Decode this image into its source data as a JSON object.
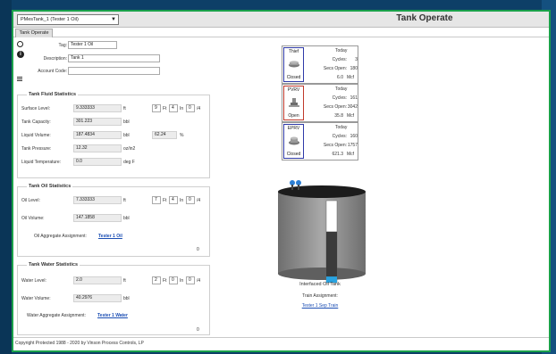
{
  "header": {
    "tank_selector_value": "PMesTank_1 (Tester 1 Oil)",
    "title": "Tank Operate"
  },
  "tabs": [
    {
      "label": "Tank Operate"
    }
  ],
  "info": {
    "tag_label": "Tag:",
    "tag_value": "Tester 1 Oil",
    "description_label": "Description:",
    "description_value": "Tank 1",
    "account_code_label": "Account Code:",
    "account_code_value": ""
  },
  "fluid": {
    "title": "Tank Fluid Statistics",
    "surface_level_label": "Surface Level:",
    "surface_level": "9.333333",
    "surface_level_unit": "ft",
    "ft_value": "9",
    "ft_label": "Ft",
    "in_value": "4",
    "in_label": "In",
    "frac_value": "0",
    "frac_label": "/4",
    "capacity_label": "Tank Capacity:",
    "capacity": "301.223",
    "capacity_unit": "bbl",
    "liquid_volume_label": "Liquid Volume:",
    "liquid_volume": "187.4834",
    "liquid_volume_unit": "bbl",
    "percent": "62.24",
    "percent_unit": "%",
    "pressure_label": "Tank Pressure:",
    "pressure": "12.32",
    "pressure_unit": "oz/in2",
    "temperature_label": "Liquid Temperature:",
    "temperature": "0.0",
    "temperature_unit": "deg F"
  },
  "oil": {
    "title": "Tank Oil Statistics",
    "level_label": "Oil Level:",
    "level": "7.333333",
    "level_unit": "ft",
    "ft_value": "7",
    "ft_label": "Ft",
    "in_value": "4",
    "in_label": "In",
    "frac_value": "0",
    "frac_label": "/4",
    "volume_label": "Oil Volume:",
    "volume": "147.1858",
    "volume_unit": "bbl",
    "aggregate_label": "Oil Aggregate Assignment:",
    "aggregate_link": "Tester 1 Oil",
    "count": "0"
  },
  "water": {
    "title": "Tank Water Statistics",
    "level_label": "Water Level:",
    "level": "2.0",
    "level_unit": "ft",
    "ft_value": "2",
    "ft_label": "Ft",
    "in_value": "0",
    "in_label": "In",
    "frac_value": "0",
    "frac_label": "/4",
    "volume_label": "Water Volume:",
    "volume": "40.2976",
    "volume_unit": "bbl",
    "aggregate_label": "Water Aggregate Assignment:",
    "aggregate_link": "Tester 1 Water",
    "count": "0"
  },
  "valves": [
    {
      "name": "Thief",
      "state": "Closed",
      "border_color": "#2f3aa8",
      "today_label": "Today",
      "cycles_label": "Cycles:",
      "cycles": "3",
      "secs_label": "Secs Open:",
      "secs": "180",
      "mcf": "6.0",
      "mcf_unit": "Mcf"
    },
    {
      "name": "PVRV",
      "state": "Open",
      "border_color": "#c0392b",
      "today_label": "Today",
      "cycles_label": "Cycles:",
      "cycles": "161",
      "secs_label": "Secs Open:",
      "secs": "3042",
      "mcf": "35.8",
      "mcf_unit": "Mcf"
    },
    {
      "name": "EPRV",
      "state": "Closed",
      "border_color": "#2f3aa8",
      "today_label": "Today",
      "cycles_label": "Cycles:",
      "cycles": "160",
      "secs_label": "Secs Open:",
      "secs": "1757",
      "mcf": "621.3",
      "mcf_unit": "Mcf"
    }
  ],
  "tank_graphic": {
    "label": "Interfaced Oil Tank",
    "train_label": "Train Assignment:",
    "train_link": "Tester 1 Sep Train",
    "surface_fraction": 0.6224,
    "water_fraction": 0.075,
    "colors": {
      "oil": "#3b3b3b",
      "water": "#29a3e0",
      "shell": "#8a8a8a"
    }
  },
  "footer": {
    "text": "Copyright Protected 1988 - 2020 by Vinson Process Controls, LP"
  }
}
